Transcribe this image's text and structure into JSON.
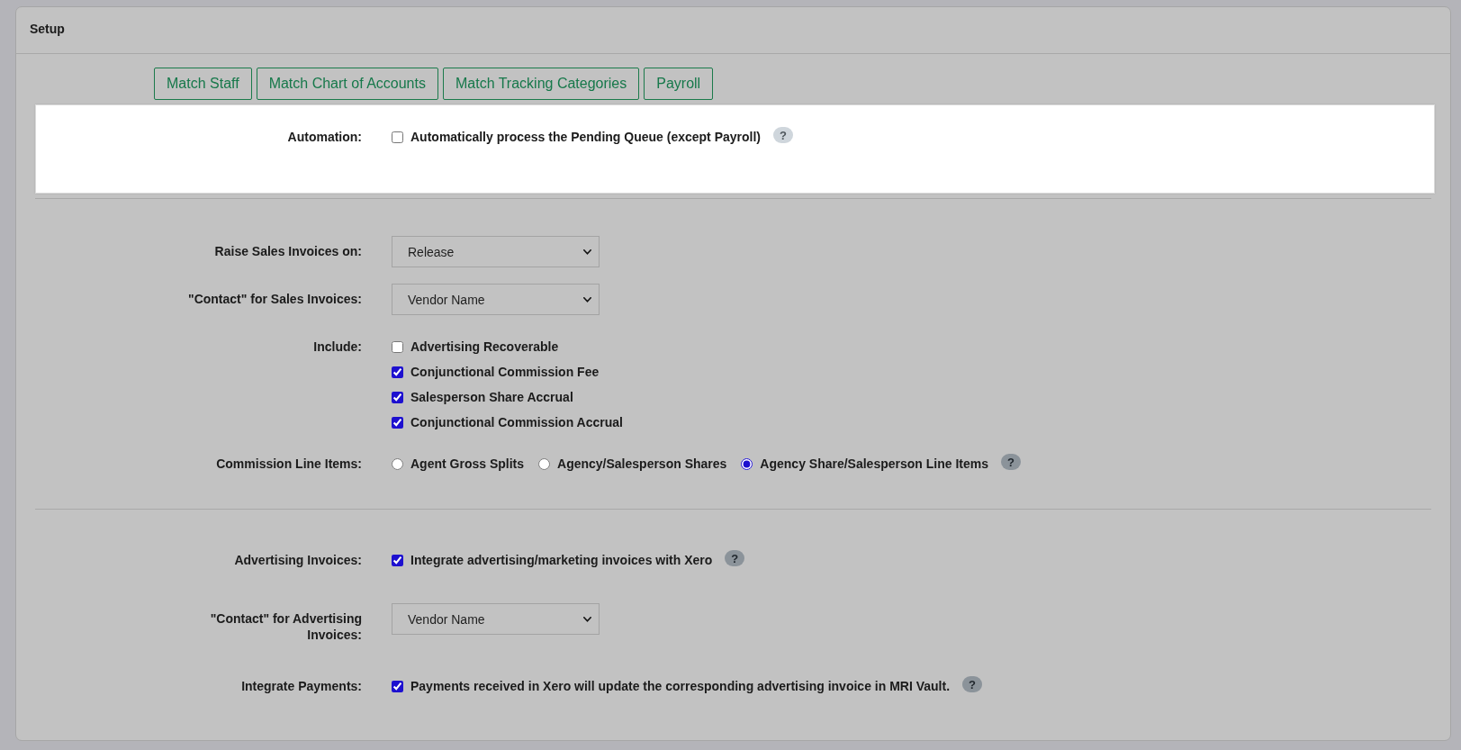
{
  "panel": {
    "title": "Setup"
  },
  "nav_buttons": [
    {
      "label": "Match Staff"
    },
    {
      "label": "Match Chart of Accounts"
    },
    {
      "label": "Match Tracking Categories"
    },
    {
      "label": "Payroll"
    }
  ],
  "sections": [
    {
      "kind": "card",
      "rows": [
        {
          "kind": "checkboxes",
          "label": "Automation:",
          "options": [
            {
              "label": "Automatically process the Pending Queue (except Payroll)",
              "checked": false
            }
          ],
          "help": "?"
        }
      ]
    },
    {
      "kind": "plain",
      "rows": [
        {
          "kind": "select",
          "label": "Raise Sales Invoices on:",
          "value": "Release"
        },
        {
          "kind": "select",
          "label": "\"Contact\" for Sales Invoices:",
          "value": "Vendor Name"
        },
        {
          "kind": "checkboxes",
          "label": "Include:",
          "options": [
            {
              "label": "Advertising Recoverable",
              "checked": false
            },
            {
              "label": "Conjunctional Commission Fee",
              "checked": true
            },
            {
              "label": "Salesperson Share Accrual",
              "checked": true
            },
            {
              "label": "Conjunctional Commission Accrual",
              "checked": true
            }
          ]
        },
        {
          "kind": "radios",
          "label": "Commission Line Items:",
          "options": [
            {
              "label": "Agent Gross Splits",
              "selected": false
            },
            {
              "label": "Agency/Salesperson Shares",
              "selected": false
            },
            {
              "label": "Agency Share/Salesperson Line Items",
              "selected": true
            }
          ],
          "help": "?"
        }
      ]
    },
    {
      "kind": "plain",
      "rows": [
        {
          "kind": "checkboxes",
          "label": "Advertising Invoices:",
          "options": [
            {
              "label": "Integrate advertising/marketing invoices with Xero",
              "checked": true
            }
          ],
          "help": "?"
        },
        {
          "kind": "select",
          "label": "\"Contact\" for Advertising Invoices:",
          "value": "Vendor Name"
        },
        {
          "kind": "checkboxes",
          "label": "Integrate Payments:",
          "options": [
            {
              "label": "Payments received in Xero will update the corresponding advertising invoice in MRI Vault.",
              "checked": true
            }
          ],
          "help": "?"
        }
      ]
    }
  ]
}
